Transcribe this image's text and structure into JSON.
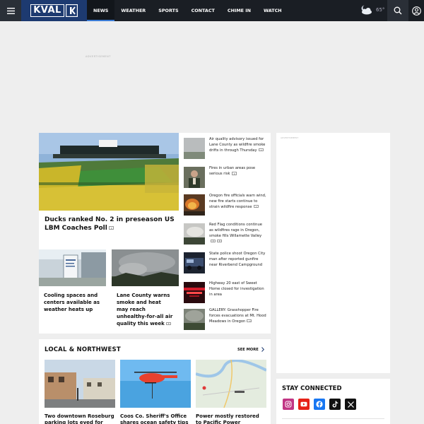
{
  "header": {
    "logo_text": "KVAL",
    "nav": [
      {
        "label": "NEWS",
        "active": true
      },
      {
        "label": "WEATHER"
      },
      {
        "label": "SPORTS"
      },
      {
        "label": "CONTACT"
      },
      {
        "label": "CHIME IN"
      },
      {
        "label": "WATCH"
      }
    ],
    "weather_temp": "65°",
    "weather_icon": "partly-cloudy-night-icon"
  },
  "ads": {
    "top_label": "ADVERTISEMENT",
    "right_label": "ADVERTISEMENT"
  },
  "top_story": {
    "title": "Ducks ranked No. 2 in preseason US LBM Coaches Poll",
    "has_video": true
  },
  "sub_stories": [
    {
      "title": "Cooling spaces and centers available as weather heats up",
      "has_video": false
    },
    {
      "title": "Lane County warns smoke and heat may reach unhealthy-for-all air quality this week",
      "has_video": true
    }
  ],
  "side_stories": [
    {
      "title": "Air quality advisory issued for Lane County as wildfire smoke drifts in through Thursday",
      "video": 1
    },
    {
      "title": "Fires in urban areas pose serious risk",
      "video": 1
    },
    {
      "title": "Oregon fire officials warn wind, new fire starts continue to strain wildfire response",
      "video": 1
    },
    {
      "title": "Red Flag conditions continue as wildfires rage in Oregon, smoke fills Willamette Valley",
      "video": 2
    },
    {
      "title": "State police shoot Oregon City man after reported gunfire near Riverbend Campground",
      "video": 0
    },
    {
      "title": "Highway 20 east of Sweet Home closed for investigation in area",
      "video": 0
    },
    {
      "title": "GALLERY: Grasshopper Fire forces evacuations at Mt. Hood Meadows in Oregon",
      "video": 1
    }
  ],
  "local": {
    "header": "LOCAL & NORTHWEST",
    "see_more": "SEE MORE",
    "items": [
      {
        "title": "Two downtown Roseburg parking lots eyed for"
      },
      {
        "title": "Coos Co. Sheriff's Office shares ocean safety tips"
      },
      {
        "title": "Power mostly restored to Pacific Power customers"
      }
    ]
  },
  "stay_connected": {
    "title": "STAY CONNECTED",
    "social": [
      {
        "icon": "instagram-icon",
        "color": "#c13584"
      },
      {
        "icon": "youtube-icon",
        "color": "#e62117"
      },
      {
        "icon": "facebook-icon",
        "color": "#1877f2"
      },
      {
        "icon": "tiktok-icon",
        "color": "#111111"
      },
      {
        "icon": "x-icon",
        "color": "#111111"
      }
    ]
  },
  "colors": {
    "topbar": "#1a1e24",
    "logo_bg": "#1d3a70",
    "accent": "#3a7bd5"
  }
}
